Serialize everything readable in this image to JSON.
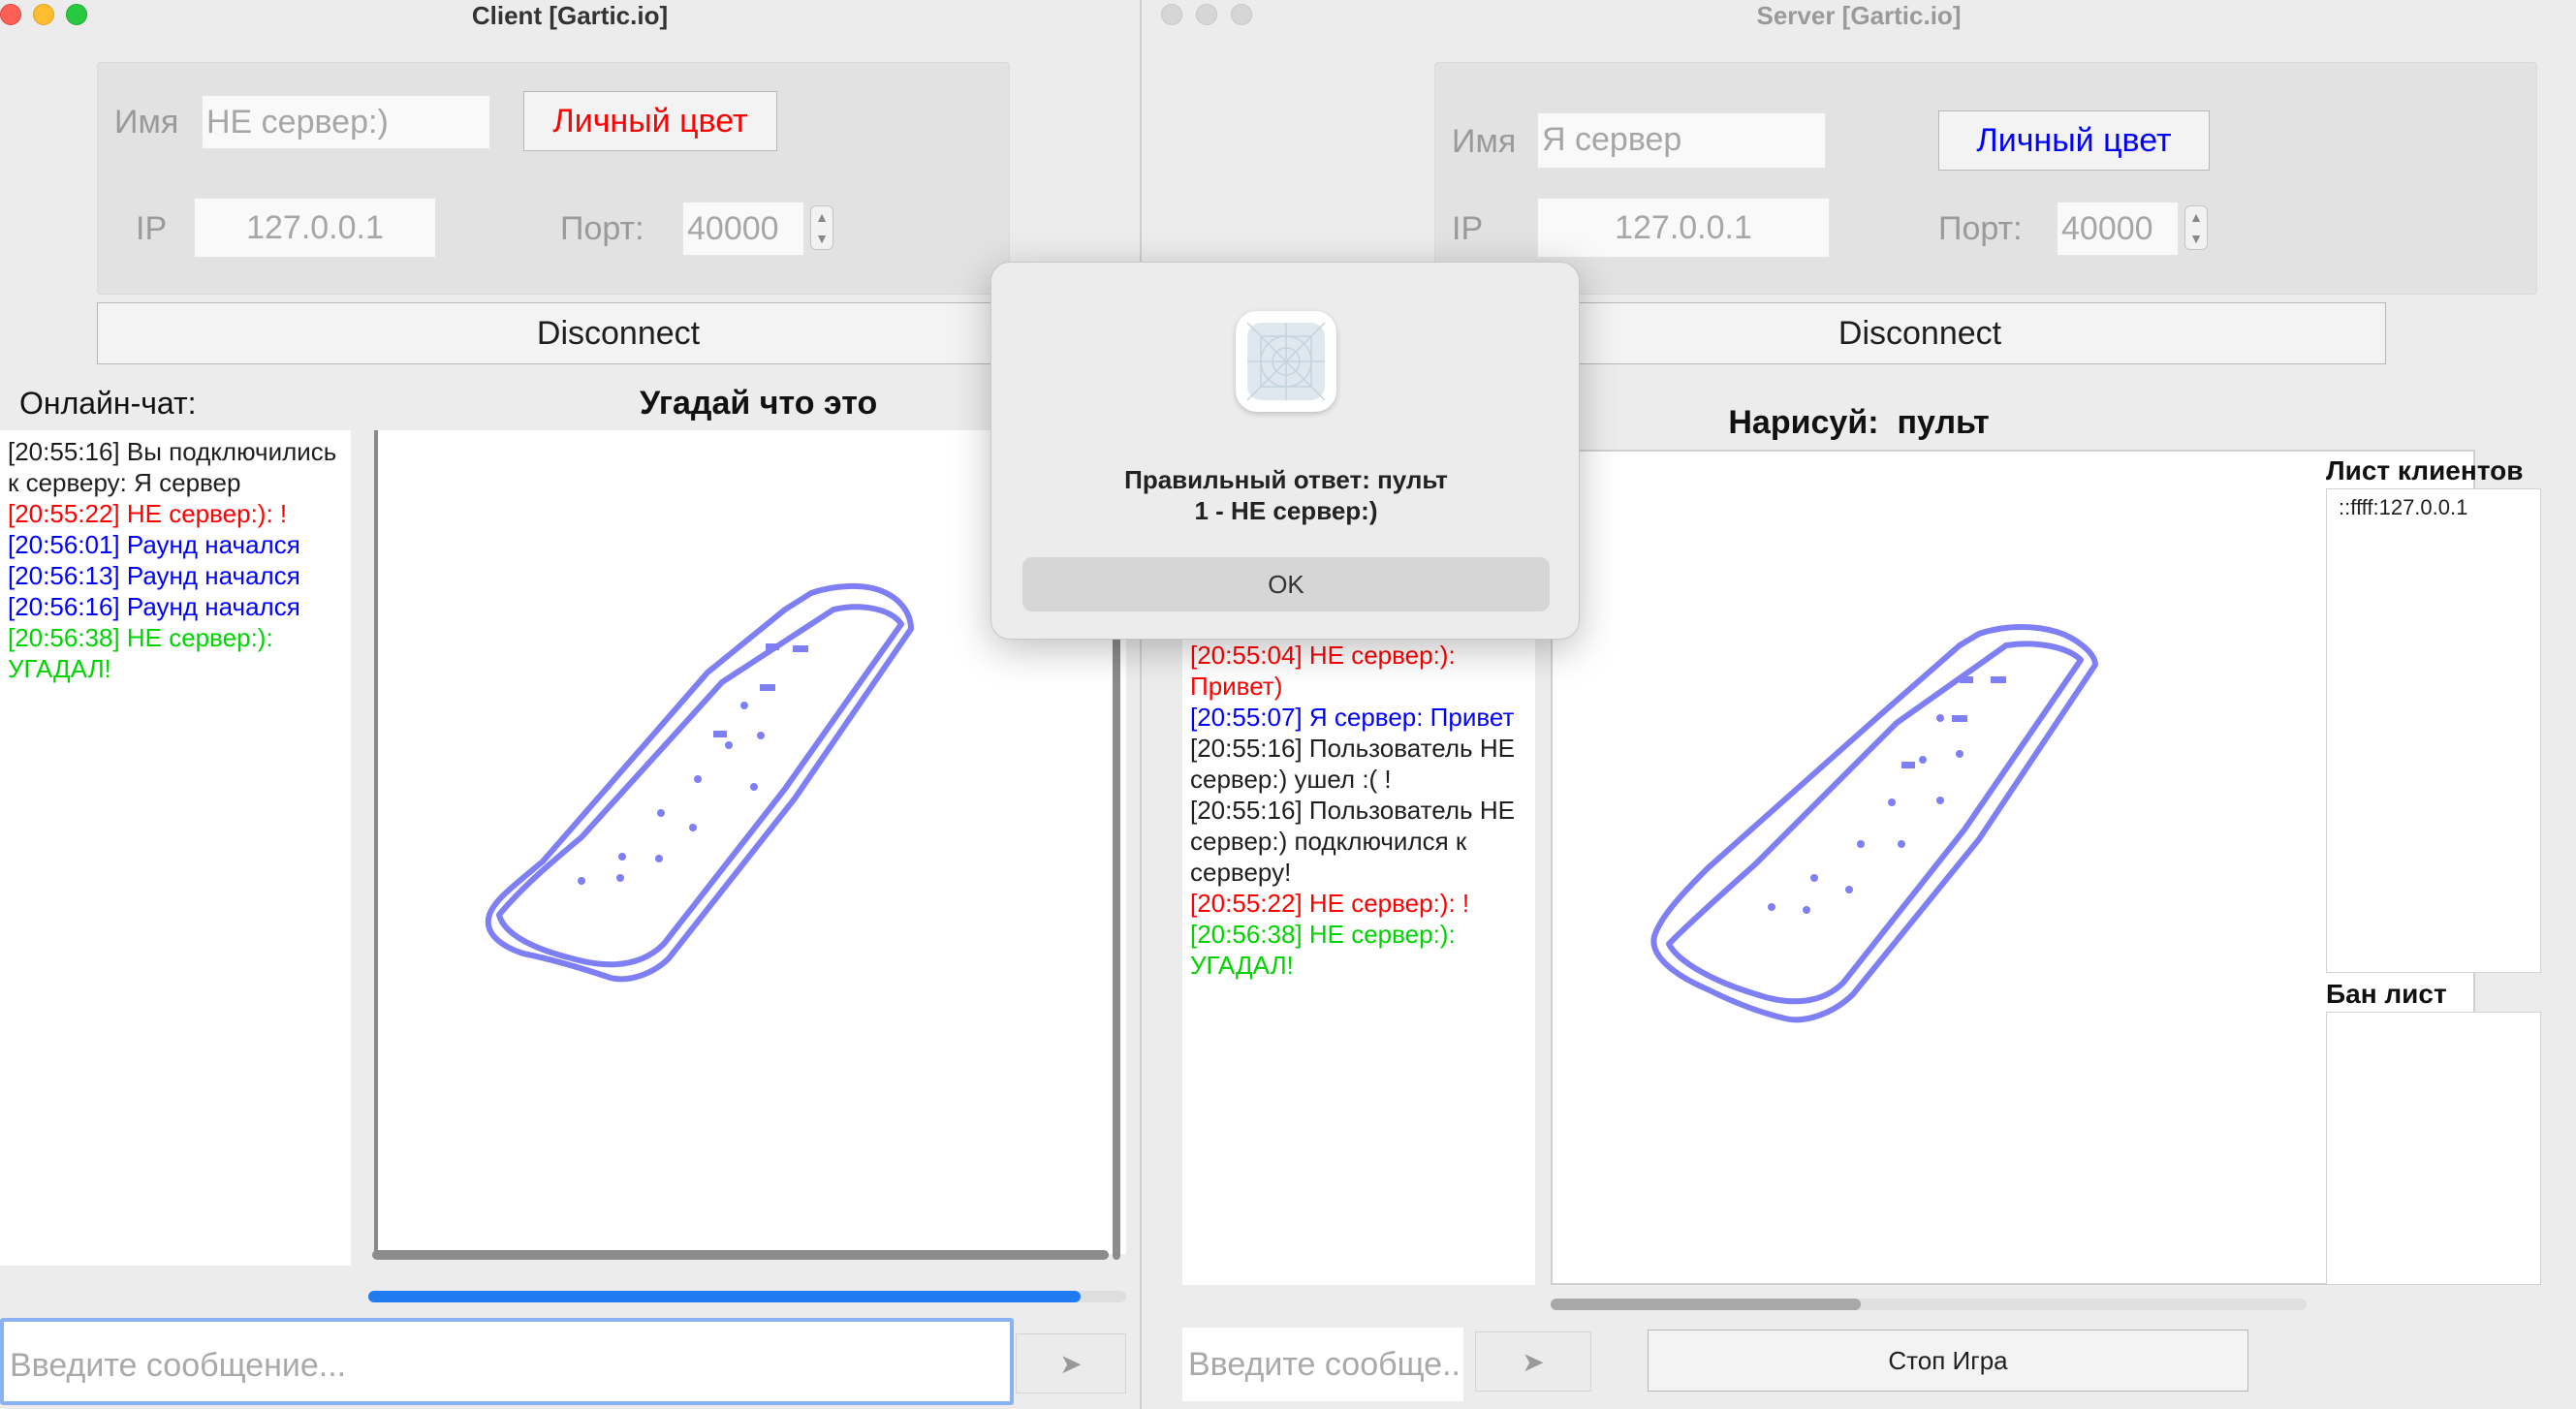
{
  "colors": {
    "red": "#ff0000",
    "blue": "#0000ff",
    "green": "#00d400",
    "stroke": "#7e7ef5",
    "accent": "#1e7cf0"
  },
  "client": {
    "title": "Client [Gartic.io]",
    "name_label": "Имя",
    "name_value": "НЕ сервер:)",
    "color_button": "Личный цвет",
    "ip_label": "IP",
    "ip_value": "127.0.0.1",
    "port_label": "Порт:",
    "port_value": "40000",
    "disconnect": "Disconnect",
    "chat_title": "Онлайн-чат:",
    "canvas_title": "Угадай что это",
    "messages": [
      {
        "text": "[20:55:16] Вы подключились к серверу: Я сервер",
        "color": "#1e1e1e"
      },
      {
        "text": "[20:55:22] НЕ сервер:): !",
        "color": "#ff0000"
      },
      {
        "text": "[20:56:01] Раунд начался",
        "color": "#0000ff"
      },
      {
        "text": "[20:56:13] Раунд начался",
        "color": "#0000ff"
      },
      {
        "text": "[20:56:16] Раунд начался",
        "color": "#0000ff"
      },
      {
        "text": "[20:56:38] НЕ сервер:): УГАДАЛ!",
        "color": "#00d400"
      }
    ],
    "timer_progress": 0.94,
    "input_placeholder": "Введите сообщение...",
    "send_icon": "➤"
  },
  "server": {
    "title": "Server [Gartic.io]",
    "name_label": "Имя",
    "name_value": "Я сервер",
    "color_button": "Личный цвет",
    "ip_label": "IP",
    "ip_value": "127.0.0.1",
    "port_label": "Порт:",
    "port_value": "40000",
    "disconnect": "Disconnect",
    "draw_title": "Нарисуй:  пульт",
    "messages": [
      {
        "text": "[20:55:04] НЕ сервер:): Привет)",
        "color": "#ff0000"
      },
      {
        "text": "[20:55:07] Я сервер: Привет",
        "color": "#0000ff"
      },
      {
        "text": "[20:55:16] Пользователь НЕ сервер:) ушел :( !",
        "color": "#1e1e1e"
      },
      {
        "text": "[20:55:16] Пользователь НЕ сервер:) подключился к серверу!",
        "color": "#1e1e1e"
      },
      {
        "text": "[20:55:22] НЕ сервер:): !",
        "color": "#ff0000"
      },
      {
        "text": "[20:56:38] НЕ сервер:): УГАДАЛ!",
        "color": "#00d400"
      }
    ],
    "clients_title": "Лист клиентов",
    "clients": [
      "::ffff:127.0.0.1"
    ],
    "ban_title": "Бан лист",
    "input_placeholder": "Введите сообще...",
    "send_icon": "➤",
    "stop_button": "Стоп Игра"
  },
  "dialog": {
    "line1": "Правильный ответ: пульт",
    "line2": "1 - НЕ сервер:)",
    "ok": "OK",
    "icon": "app-placeholder-icon"
  }
}
